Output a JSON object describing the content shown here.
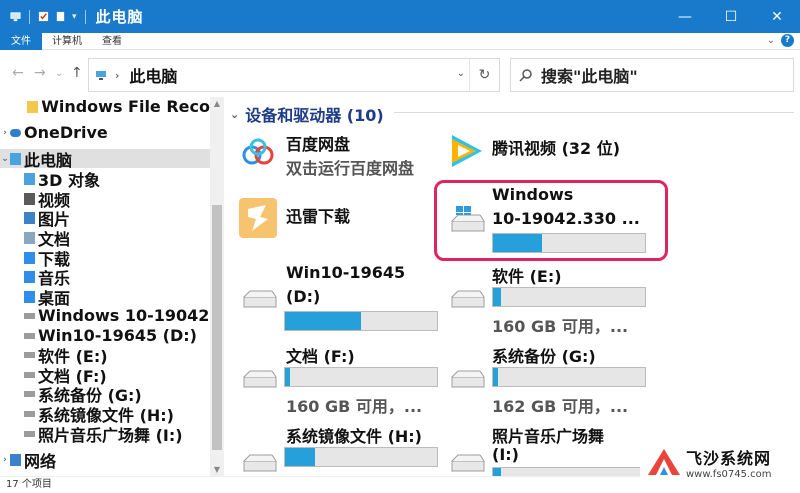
{
  "window": {
    "title": "此电脑",
    "minimize": "—",
    "maximize": "☐",
    "close": "✕"
  },
  "ribbon": {
    "tabs": [
      "文件",
      "计算机",
      "查看"
    ],
    "expand": "⌄",
    "help": "?"
  },
  "nav": {
    "back": "←",
    "forward": "→",
    "recent": "⌄",
    "up": "↑",
    "address_chevron": "›",
    "address": "此电脑",
    "address_dropdown": "⌄",
    "refresh": "↻",
    "search_placeholder": "搜索\"此电脑\""
  },
  "sidebar": {
    "items": [
      {
        "label": "Windows File Reco",
        "icon": "folder-icon"
      },
      {
        "label": "OneDrive",
        "icon": "cloud-icon"
      },
      {
        "label": "此电脑",
        "icon": "computer-icon"
      },
      {
        "label": "3D 对象",
        "icon": "3d-objects-icon"
      },
      {
        "label": "视频",
        "icon": "video-folder-icon"
      },
      {
        "label": "图片",
        "icon": "pictures-folder-icon"
      },
      {
        "label": "文档",
        "icon": "documents-folder-icon"
      },
      {
        "label": "下载",
        "icon": "downloads-folder-icon"
      },
      {
        "label": "音乐",
        "icon": "music-folder-icon"
      },
      {
        "label": "桌面",
        "icon": "desktop-folder-icon"
      },
      {
        "label": "Windows 10-19042",
        "icon": "drive-icon"
      },
      {
        "label": "Win10-19645 (D:)",
        "icon": "drive-icon"
      },
      {
        "label": "软件 (E:)",
        "icon": "drive-icon"
      },
      {
        "label": "文档 (F:)",
        "icon": "drive-icon"
      },
      {
        "label": "系统备份 (G:)",
        "icon": "drive-icon"
      },
      {
        "label": "系统镜像文件 (H:)",
        "icon": "drive-icon"
      },
      {
        "label": "照片音乐广场舞 (I:)",
        "icon": "drive-icon"
      },
      {
        "label": "网络",
        "icon": "network-icon"
      }
    ]
  },
  "main": {
    "group_label": "设备和驱动器 (10)",
    "apps": [
      {
        "name": "百度网盘",
        "sub": "双击运行百度网盘",
        "icon": "baidu-netdisk-icon"
      },
      {
        "name": "腾讯视频 (32 位)",
        "icon": "tencent-video-icon"
      },
      {
        "name": "迅雷下载",
        "icon": "xunlei-icon"
      }
    ],
    "drives": [
      {
        "name_line1": "Windows",
        "name_line2": "10-19042.330 ...",
        "used_fraction": 0.32,
        "icon": "windows-drive-icon"
      },
      {
        "name_line1": "Win10-19645",
        "name_line2": "(D:)",
        "used_fraction": 0.5,
        "icon": "drive-icon"
      },
      {
        "name": "软件 (E:)",
        "sub": "160 GB 可用，...",
        "used_fraction": 0.05,
        "icon": "drive-icon"
      },
      {
        "name": "文档 (F:)",
        "sub": "160 GB 可用，...",
        "used_fraction": 0.03,
        "icon": "drive-icon"
      },
      {
        "name": "系统备份 (G:)",
        "sub": "162 GB 可用，...",
        "used_fraction": 0.03,
        "icon": "drive-icon"
      },
      {
        "name": "系统镜像文件 (H:)",
        "used_fraction": 0.2,
        "icon": "drive-icon"
      },
      {
        "name_line1": "照片音乐广场舞",
        "name_line2": "(I:)",
        "used_fraction": 0.05,
        "icon": "drive-icon"
      }
    ]
  },
  "status": {
    "count": "17 个项目"
  },
  "watermark": {
    "title": "飞沙系统网",
    "url": "www.fs0745.com"
  },
  "colors": {
    "titlebar": "#1979ca",
    "bar_fill": "#26a0da",
    "highlight": "#e0245e",
    "group_heading": "#1e3c87"
  }
}
